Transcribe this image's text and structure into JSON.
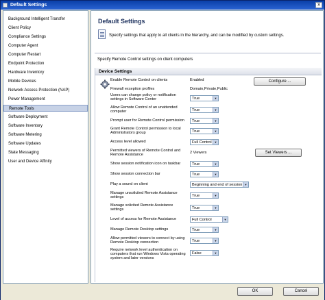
{
  "window": {
    "title": "Default Settings",
    "close_glyph": "×"
  },
  "sidebar": {
    "items": [
      {
        "label": "Background Intelligent Transfer"
      },
      {
        "label": "Client Policy"
      },
      {
        "label": "Compliance Settings"
      },
      {
        "label": "Computer Agent"
      },
      {
        "label": "Computer Restart"
      },
      {
        "label": "Endpoint Protection"
      },
      {
        "label": "Hardware Inventory"
      },
      {
        "label": "Mobile Devices"
      },
      {
        "label": "Network Access Protection (NAP)"
      },
      {
        "label": "Power Management"
      },
      {
        "label": "Remote Tools"
      },
      {
        "label": "Software Deployment"
      },
      {
        "label": "Software Inventory"
      },
      {
        "label": "Software Metering"
      },
      {
        "label": "Software Updates"
      },
      {
        "label": "State Messaging"
      },
      {
        "label": "User and Device Affinity"
      }
    ],
    "selected": "Remote Tools"
  },
  "main": {
    "title": "Default Settings",
    "description": "Specify settings that apply to all clients in the hierarchy, and can be modified by custom settings.",
    "subtitle": "Specify Remote Control settings on client computers",
    "group_title": "Device Settings"
  },
  "settings": [
    {
      "label": "Enable Remote Control on clients",
      "value": "Enabled"
    },
    {
      "label": "Firewall exception profiles",
      "value": "Domain,Private,Public"
    },
    {
      "label": "Users can change policy or notification settings in Software Center",
      "value": "True"
    },
    {
      "label": "Allow Remote Control of an unattended computer",
      "value": "True"
    },
    {
      "label": "Prompt user for Remote Control permission",
      "value": "True"
    },
    {
      "label": "Grant Remote Control permission to local Administrators group",
      "value": "True"
    },
    {
      "label": "Access level allowed",
      "value": "Full Control"
    },
    {
      "label": "Permitted viewers of Remote Control and Remote Assistance",
      "value": "2 Viewers"
    },
    {
      "label": "Show session notification icon on taskbar",
      "value": "True"
    },
    {
      "label": "Show session connection bar",
      "value": "True"
    },
    {
      "label": "Play a sound on client",
      "value": "Beginning and end of session"
    },
    {
      "label": "Manage unsolicited Remote Assistance settings",
      "value": "True"
    },
    {
      "label": "Manage solicited Remote Assistance settings",
      "value": "True"
    },
    {
      "label": "Level of access for Remote Assistance",
      "value": "Full Control"
    },
    {
      "label": "Manage Remote Desktop settings",
      "value": "True"
    },
    {
      "label": "Allow permitted viewers to connect by using Remote Desktop connection",
      "value": "True"
    },
    {
      "label": "Require network level authentication on computers that run Windows Vista operating system and later versions",
      "value": "False"
    }
  ],
  "buttons": {
    "configure": "Configure ...",
    "set_viewers": "Set Viewers ...",
    "ok": "OK",
    "cancel": "Cancel"
  },
  "icons": {
    "gear": "gear-icon",
    "doc": "document-icon"
  },
  "colors": {
    "title_bar": "#0a3fa8",
    "selected_item": "#c7d2e6",
    "title_text": "#1b2f5c"
  }
}
